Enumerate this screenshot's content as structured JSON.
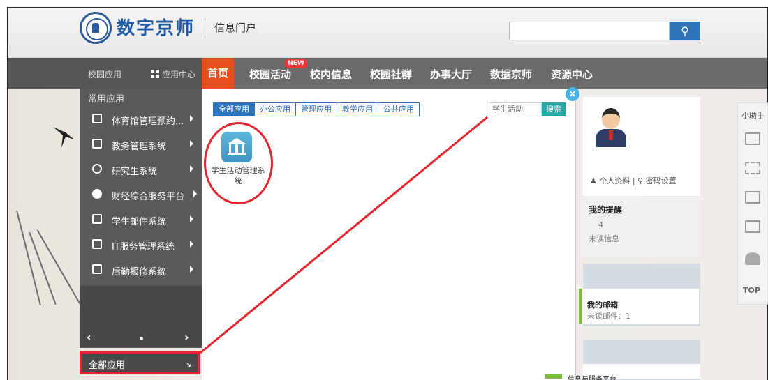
{
  "header": {
    "logo_text": "数字京师",
    "logo_sub": "信息门户",
    "search_placeholder": "",
    "search_icon": "search-icon"
  },
  "nav": {
    "campus_apps": "校园应用",
    "app_center": "应用中心",
    "items": [
      "首页",
      "校园活动",
      "校内信息",
      "校园社群",
      "办事大厅",
      "数据京师",
      "资源中心"
    ],
    "new_badge": "NEW",
    "active_index": 0
  },
  "sidebar": {
    "title": "常用应用",
    "items": [
      {
        "label": "体育馆管理预约...",
        "icon": "document-icon"
      },
      {
        "label": "教务管理系统",
        "icon": "list-icon"
      },
      {
        "label": "研究生系统",
        "icon": "graduation-cap-icon"
      },
      {
        "label": "财经综合服务平台",
        "icon": "finance-icon"
      },
      {
        "label": "学生邮件系统",
        "icon": "document-icon"
      },
      {
        "label": "IT服务管理系统",
        "icon": "monitor-icon"
      },
      {
        "label": "后勤报修系统",
        "icon": "document-icon"
      }
    ],
    "pager_prev": "‹",
    "pager_next": "›",
    "all_apps": "全部应用"
  },
  "popup": {
    "close": "×",
    "tabs": [
      "全部应用",
      "办公应用",
      "管理应用",
      "教学应用",
      "公共应用"
    ],
    "active_tab": 0,
    "search_value": "学生活动",
    "search_button": "搜索",
    "apps": [
      {
        "label": "学生活动管理系统",
        "icon": "university-building-icon"
      }
    ]
  },
  "profile": {
    "personal_info": "个人资料",
    "separator": "|",
    "password_settings": "密码设置"
  },
  "reminder": {
    "title": "我的提醒",
    "count": "4",
    "label": "未读信息"
  },
  "mail": {
    "title": "我的邮箱",
    "unread": "未读邮件：1"
  },
  "lower": {
    "title": "信息与服务平台"
  },
  "helper": {
    "title": "小助手",
    "top": "TOP",
    "icons": [
      "mail-icon",
      "grid-icon",
      "calendar-icon",
      "window-icon",
      "user-icon"
    ]
  },
  "colors": {
    "brand_blue": "#1f5aa6",
    "nav_active": "#e84f1c",
    "annotation_red": "#e5232d",
    "tab_blue": "#2f72b8",
    "accent_green": "#7bbf3c"
  }
}
